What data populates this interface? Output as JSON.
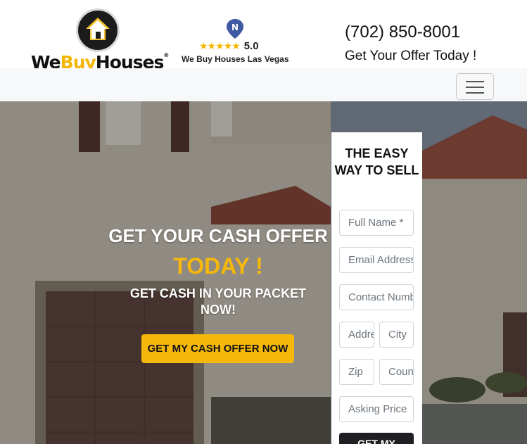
{
  "brand": {
    "logo_text_pre": "We",
    "logo_text_mid": "Buy",
    "logo_text_post": "Houses",
    "registered_mark": "®",
    "accent_color": "#f2b705",
    "logo_icon": "house-icon"
  },
  "review": {
    "icon": "review-badge-icon",
    "stars": "★★★★★",
    "rating": "5.0",
    "business_name": "We Buy Houses Las Vegas"
  },
  "contact": {
    "phone": "(702) 850-8001",
    "tagline": "Get Your Offer Today !"
  },
  "nav": {
    "toggler_icon": "hamburger-menu-icon"
  },
  "hero": {
    "line1": "GET YOUR CASH OFFER",
    "line2": "TODAY !",
    "line3": "GET CASH IN YOUR PACKET NOW!",
    "cta_label": "GET MY CASH OFFER NOW",
    "cta_color": "#f5b80b"
  },
  "form": {
    "title": "THE EASY WAY TO SELL",
    "fields": {
      "full_name": "Full Name *",
      "email": "Email Address",
      "contact_number": "Contact Number",
      "address": "Address",
      "city": "City",
      "zip": "Zip",
      "country": "Country",
      "asking_price": "Asking Price"
    },
    "submit_label": "GET MY"
  }
}
